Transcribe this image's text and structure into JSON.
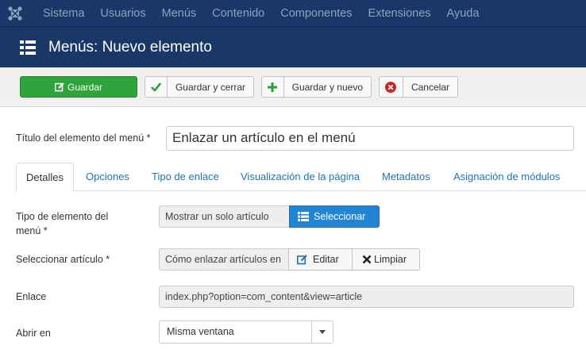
{
  "topnav": {
    "items": [
      "Sistema",
      "Usuarios",
      "Menús",
      "Contenido",
      "Componentes",
      "Extensiones",
      "Ayuda"
    ]
  },
  "header": {
    "title": "Menús: Nuevo elemento"
  },
  "toolbar": {
    "save_label": "Guardar",
    "save_close_label": "Guardar y cerrar",
    "save_new_label": "Guardar y nuevo",
    "cancel_label": "Cancelar"
  },
  "form": {
    "title_label": "Título del elemento del menú *",
    "title_value": "Enlazar un artículo en el menú"
  },
  "tabs": [
    "Detalles",
    "Opciones",
    "Tipo de enlace",
    "Visualización de la página",
    "Metadatos",
    "Asignación de módulos"
  ],
  "details": {
    "item_type_label_1": "Tipo de elemento del",
    "item_type_label_2": "menú *",
    "item_type_value": "Mostrar un solo artículo",
    "select_label": "Seleccionar",
    "article_label": "Seleccionar artículo *",
    "article_value": "Cómo enlazar artículos en",
    "edit_label": "Editar",
    "clear_label": "Limpiar",
    "link_label": "Enlace",
    "link_value": "index.php?option=com_content&view=article",
    "open_in_label": "Abrir en",
    "open_in_value": "Misma ventana"
  },
  "colors": {
    "nav_bg": "#1a3867",
    "save_green": "#2ea43a",
    "select_blue": "#2384d3",
    "link_blue": "#1f73b7"
  },
  "icons": {
    "logo": "joomla-logo",
    "title": "list-icon",
    "save": "edit-icon",
    "save_close": "check-icon",
    "save_new": "plus-icon",
    "cancel": "cancel-icon",
    "select": "list-icon",
    "edit": "edit-icon",
    "clear": "x-icon",
    "dropdown": "caret-down-icon"
  }
}
